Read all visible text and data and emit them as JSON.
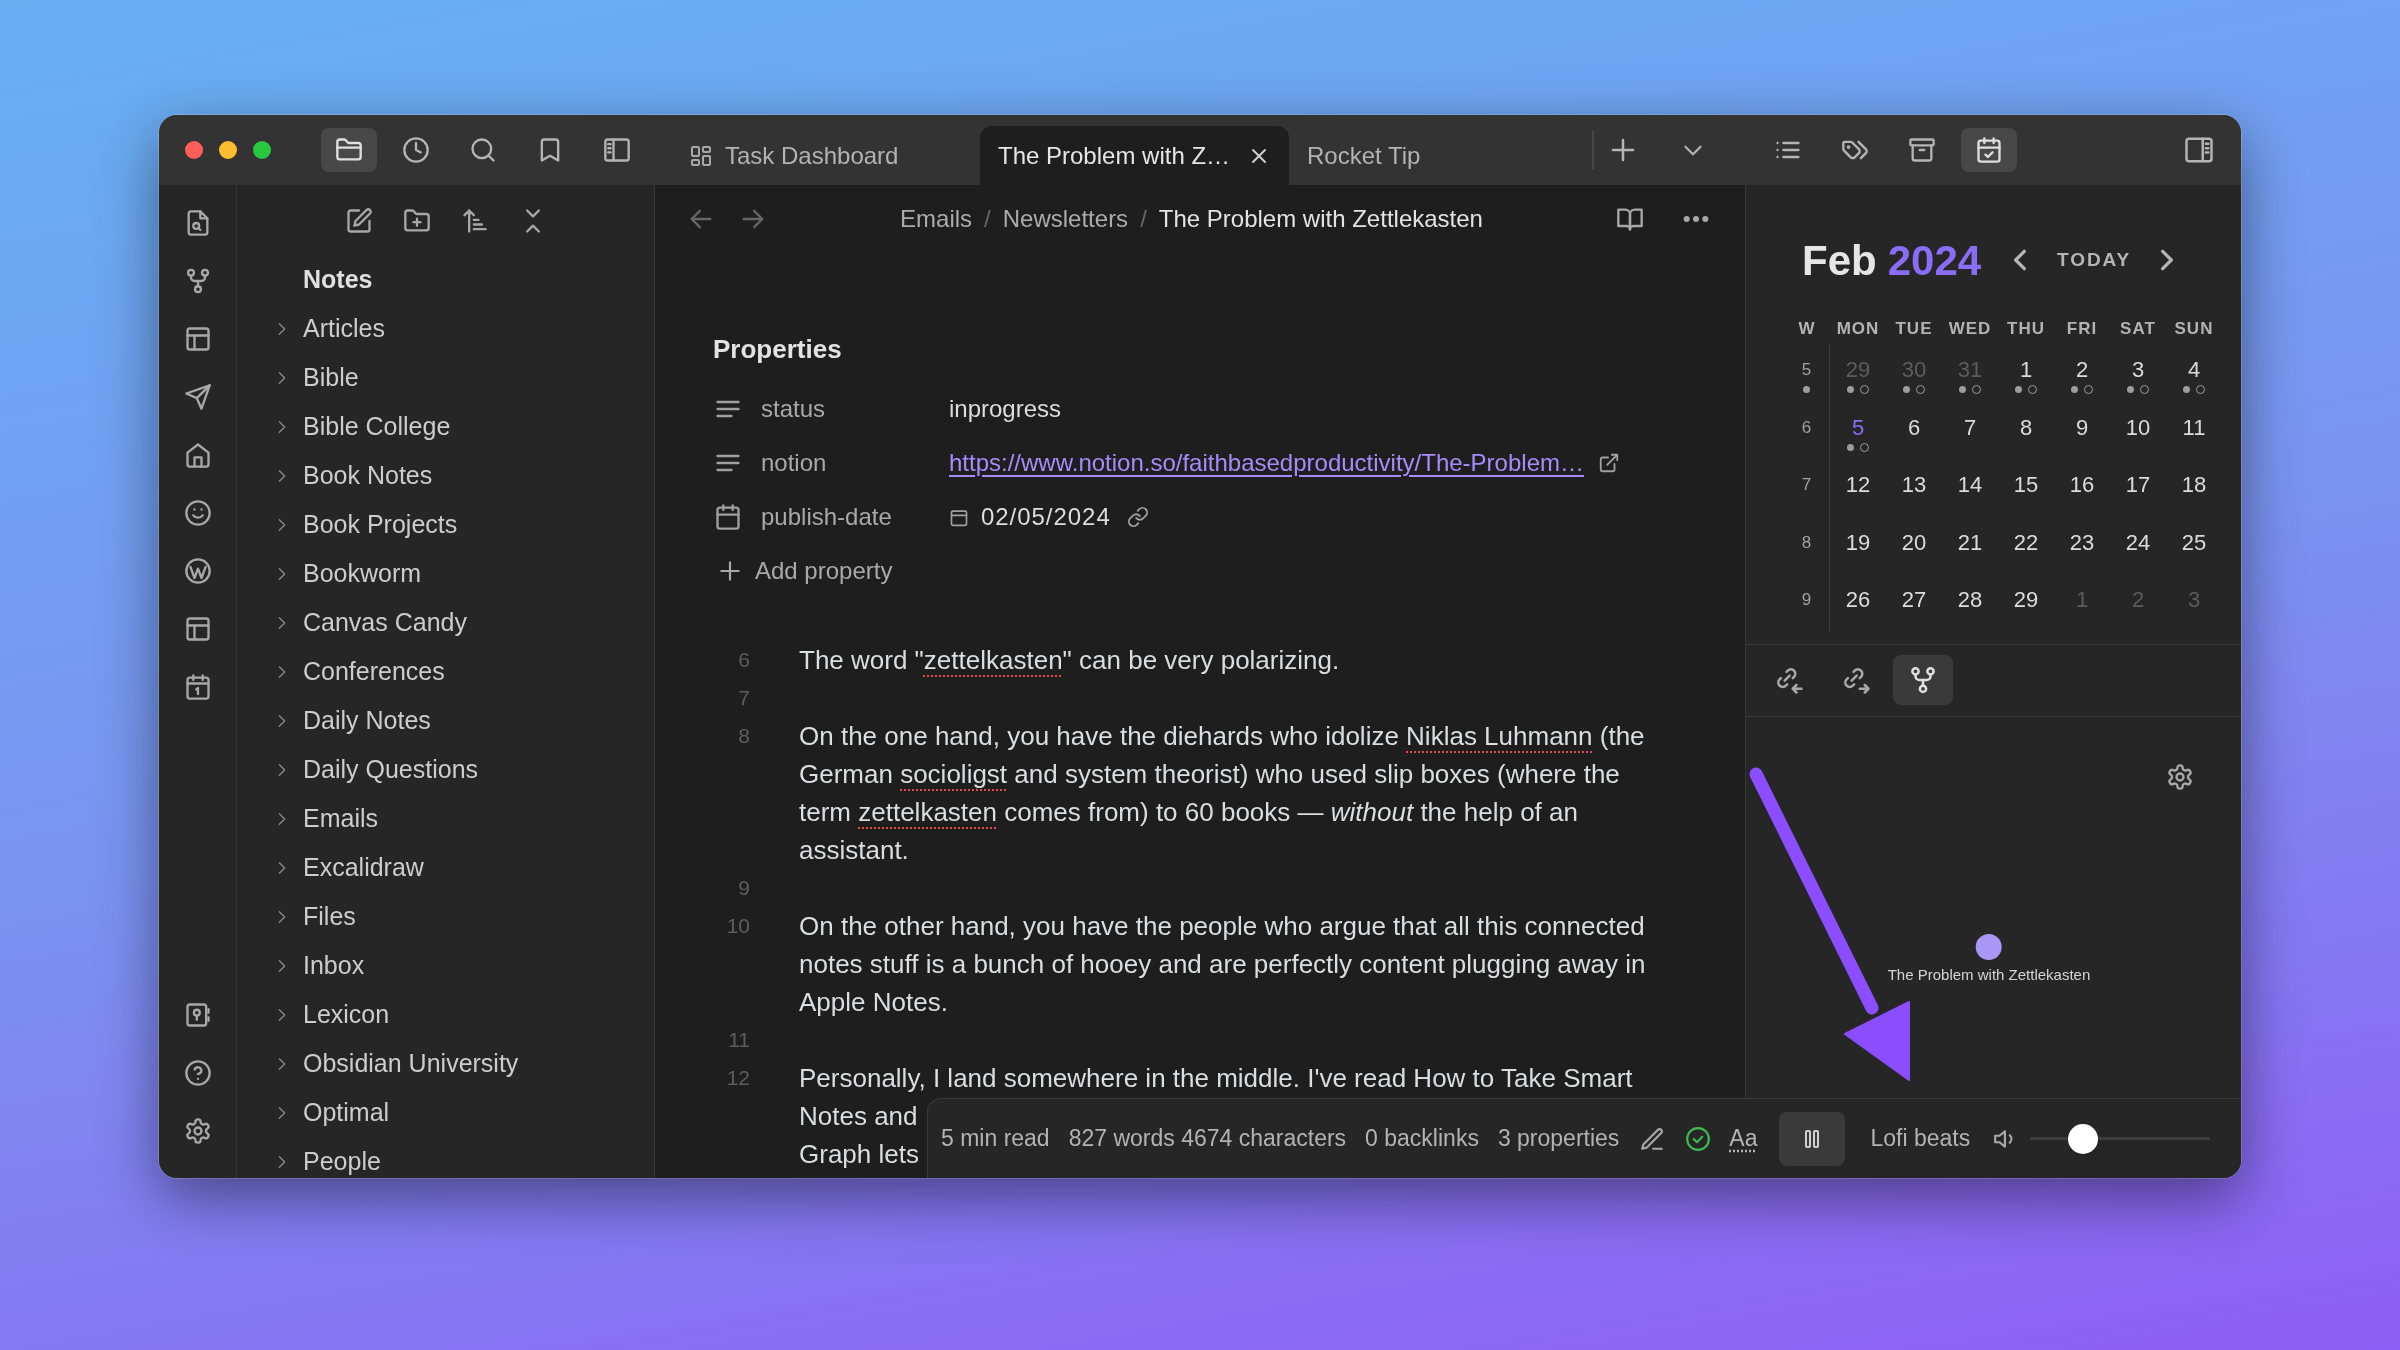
{
  "window": {
    "left_sidebar_tabs": [
      {
        "selected": true
      },
      {
        "selected": false
      },
      {
        "selected": false
      },
      {
        "selected": false
      },
      {
        "selected": false
      }
    ],
    "tabs": [
      {
        "kind": "board",
        "label": "Task Dashboard",
        "selected": false
      },
      {
        "kind": "note",
        "label": "The Problem with Z…",
        "selected": true
      },
      {
        "kind": "note",
        "label": "Rocket Tip",
        "selected": false
      }
    ],
    "right_sidebar_tabs": [
      {
        "selected": false
      },
      {
        "selected": false
      },
      {
        "selected": false
      },
      {
        "selected": true
      }
    ]
  },
  "explorer": {
    "title": "Notes",
    "folders": [
      {
        "label": "Articles",
        "expanded": false
      },
      {
        "label": "Bible",
        "expanded": false
      },
      {
        "label": "Bible College",
        "expanded": false
      },
      {
        "label": "Book Notes",
        "expanded": false
      },
      {
        "label": "Book Projects",
        "expanded": false
      },
      {
        "label": "Bookworm",
        "expanded": false
      },
      {
        "label": "Canvas Candy",
        "expanded": false
      },
      {
        "label": "Conferences",
        "expanded": false
      },
      {
        "label": "Daily Notes",
        "expanded": false
      },
      {
        "label": "Daily Questions",
        "expanded": false
      },
      {
        "label": "Emails",
        "expanded": false
      },
      {
        "label": "Excalidraw",
        "expanded": false
      },
      {
        "label": "Files",
        "expanded": false
      },
      {
        "label": "Inbox",
        "expanded": false
      },
      {
        "label": "Lexicon",
        "expanded": false
      },
      {
        "label": "Obsidian University",
        "expanded": false
      },
      {
        "label": "Optimal",
        "expanded": false
      },
      {
        "label": "People",
        "expanded": false
      }
    ]
  },
  "editor": {
    "breadcrumb": [
      "Emails",
      "Newsletters",
      "The Problem with Zettlekasten"
    ],
    "breadcrumb_separator": "/",
    "properties": {
      "title": "Properties",
      "rows": [
        {
          "kind": "text",
          "name": "status",
          "value": "inprogress"
        },
        {
          "kind": "link",
          "name": "notion",
          "value": "https://www.notion.so/faithbasedproductivity/The-Problem…"
        },
        {
          "kind": "date",
          "name": "publish-date",
          "value": "02/05/2024"
        }
      ],
      "add_label": "Add property"
    },
    "lines": [
      {
        "number": "6",
        "kind": "paragraph",
        "segments": [
          {
            "text": "The word \"",
            "misspelled": false
          },
          {
            "text": "zettelkasten",
            "misspelled": true
          },
          {
            "text": "\" can be very polarizing.",
            "misspelled": false
          }
        ]
      },
      {
        "number": "7",
        "kind": "blank"
      },
      {
        "number": "8",
        "kind": "paragraph",
        "segments": [
          {
            "text": "On the one hand, you have the diehards who idolize ",
            "misspelled": false
          },
          {
            "text": "Niklas Luhmann",
            "misspelled": true
          },
          {
            "text": " (the German ",
            "misspelled": false
          },
          {
            "text": "socioligst",
            "misspelled": true
          },
          {
            "text": " and system theorist) who used slip boxes (where the term ",
            "misspelled": false
          },
          {
            "text": "zettelkasten",
            "misspelled": true
          },
          {
            "text": " comes from) to 60 books — *without* the help of an assistant.",
            "misspelled": false
          }
        ]
      },
      {
        "number": "9",
        "kind": "blank"
      },
      {
        "number": "10",
        "kind": "paragraph",
        "segments": [
          {
            "text": "On the other hand, you have the people who argue that all this connected notes stuff is a bunch of hooey and are perfectly content plugging away in Apple Notes.",
            "misspelled": false
          }
        ]
      },
      {
        "number": "11",
        "kind": "blank"
      },
      {
        "number": "12",
        "kind": "clipped",
        "visible_lines": [
          "Personally, I land somewhere in the middle. I've read How to Take Smart",
          "Notes and",
          "Graph lets"
        ]
      }
    ]
  },
  "calendar": {
    "month": "Feb",
    "year": "2024",
    "today_label": "TODAY",
    "headers": [
      "W",
      "MON",
      "TUE",
      "WED",
      "THU",
      "FRI",
      "SAT",
      "SUN"
    ],
    "weeks": [
      {
        "number": "5",
        "dot": true,
        "days": [
          {
            "day": "29",
            "outside": true,
            "today": false,
            "dot": true,
            "ring": true
          },
          {
            "day": "30",
            "outside": true,
            "today": false,
            "dot": true,
            "ring": true
          },
          {
            "day": "31",
            "outside": true,
            "today": false,
            "dot": true,
            "ring": true
          },
          {
            "day": "1",
            "outside": false,
            "today": false,
            "dot": true,
            "ring": true
          },
          {
            "day": "2",
            "outside": false,
            "today": false,
            "dot": true,
            "ring": true
          },
          {
            "day": "3",
            "outside": false,
            "today": false,
            "dot": true,
            "ring": true
          },
          {
            "day": "4",
            "outside": false,
            "today": false,
            "dot": true,
            "ring": true
          }
        ]
      },
      {
        "number": "6",
        "dot": false,
        "days": [
          {
            "day": "5",
            "outside": false,
            "today": true,
            "dot": true,
            "ring": true
          },
          {
            "day": "6",
            "outside": false,
            "today": false,
            "dot": false,
            "ring": false
          },
          {
            "day": "7",
            "outside": false,
            "today": false,
            "dot": false,
            "ring": false
          },
          {
            "day": "8",
            "outside": false,
            "today": false,
            "dot": false,
            "ring": false
          },
          {
            "day": "9",
            "outside": false,
            "today": false,
            "dot": false,
            "ring": false
          },
          {
            "day": "10",
            "outside": false,
            "today": false,
            "dot": false,
            "ring": false
          },
          {
            "day": "11",
            "outside": false,
            "today": false,
            "dot": false,
            "ring": false
          }
        ]
      },
      {
        "number": "7",
        "dot": false,
        "days": [
          {
            "day": "12",
            "outside": false,
            "today": false,
            "dot": false,
            "ring": false
          },
          {
            "day": "13",
            "outside": false,
            "today": false,
            "dot": false,
            "ring": false
          },
          {
            "day": "14",
            "outside": false,
            "today": false,
            "dot": false,
            "ring": false
          },
          {
            "day": "15",
            "outside": false,
            "today": false,
            "dot": false,
            "ring": false
          },
          {
            "day": "16",
            "outside": false,
            "today": false,
            "dot": false,
            "ring": false
          },
          {
            "day": "17",
            "outside": false,
            "today": false,
            "dot": false,
            "ring": false
          },
          {
            "day": "18",
            "outside": false,
            "today": false,
            "dot": false,
            "ring": false
          }
        ]
      },
      {
        "number": "8",
        "dot": false,
        "days": [
          {
            "day": "19",
            "outside": false,
            "today": false,
            "dot": false,
            "ring": false
          },
          {
            "day": "20",
            "outside": false,
            "today": false,
            "dot": false,
            "ring": false
          },
          {
            "day": "21",
            "outside": false,
            "today": false,
            "dot": false,
            "ring": false
          },
          {
            "day": "22",
            "outside": false,
            "today": false,
            "dot": false,
            "ring": false
          },
          {
            "day": "23",
            "outside": false,
            "today": false,
            "dot": false,
            "ring": false
          },
          {
            "day": "24",
            "outside": false,
            "today": false,
            "dot": false,
            "ring": false
          },
          {
            "day": "25",
            "outside": false,
            "today": false,
            "dot": false,
            "ring": false
          }
        ]
      },
      {
        "number": "9",
        "dot": false,
        "days": [
          {
            "day": "26",
            "outside": false,
            "today": false,
            "dot": false,
            "ring": false
          },
          {
            "day": "27",
            "outside": false,
            "today": false,
            "dot": false,
            "ring": false
          },
          {
            "day": "28",
            "outside": false,
            "today": false,
            "dot": false,
            "ring": false
          },
          {
            "day": "29",
            "outside": false,
            "today": false,
            "dot": false,
            "ring": false
          },
          {
            "day": "1",
            "outside": true,
            "today": false,
            "dot": false,
            "ring": false
          },
          {
            "day": "2",
            "outside": true,
            "today": false,
            "dot": false,
            "ring": false
          },
          {
            "day": "3",
            "outside": true,
            "today": false,
            "dot": false,
            "ring": false
          }
        ]
      }
    ]
  },
  "panel_tabs": [
    {
      "selected": false
    },
    {
      "selected": false
    },
    {
      "selected": true
    }
  ],
  "graph": {
    "nodes": [
      {
        "label": "The Problem with Zettlekasten"
      }
    ]
  },
  "status_bar": {
    "items": [
      "5 min read",
      "827 words 4674 characters",
      "0 backlinks",
      "3 properties"
    ],
    "font_label": "Aa",
    "player": {
      "playing": true,
      "track": "Lofi beats",
      "volume": {
        "level": 0.25
      }
    }
  }
}
